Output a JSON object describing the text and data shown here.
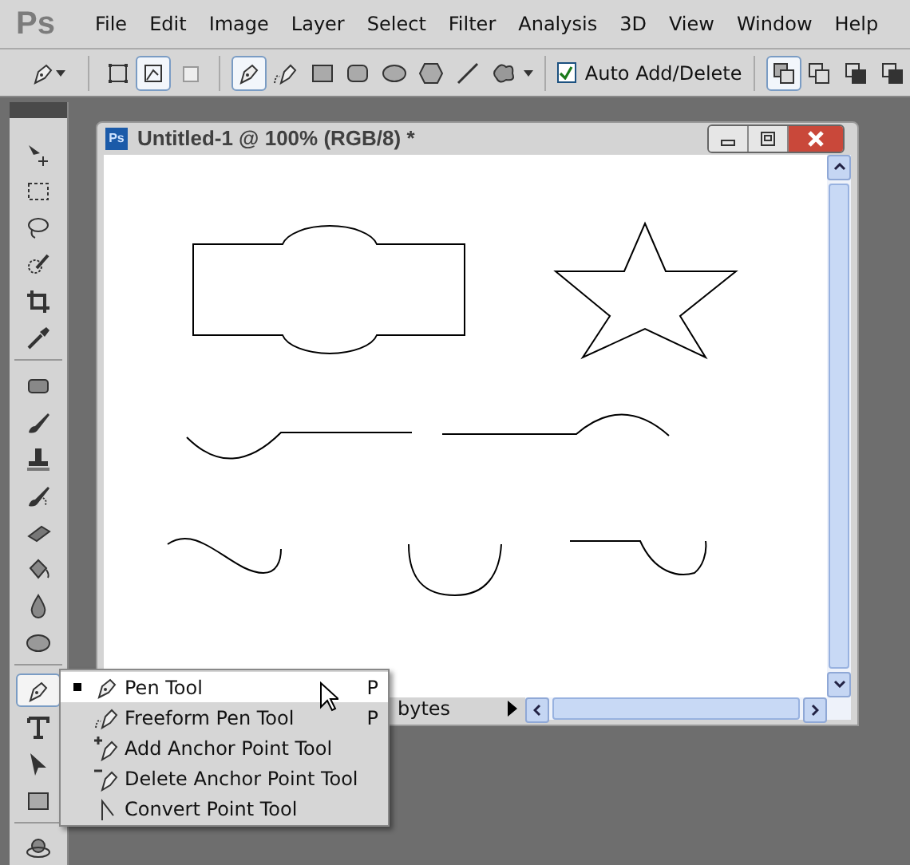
{
  "app_logo": "Ps",
  "menu": [
    "File",
    "Edit",
    "Image",
    "Layer",
    "Select",
    "Filter",
    "Analysis",
    "3D",
    "View",
    "Window",
    "Help"
  ],
  "options_bar": {
    "path_modes": [
      {
        "kind": "shape-layers",
        "selected": false
      },
      {
        "kind": "paths",
        "selected": true
      },
      {
        "kind": "fill-pixels",
        "selected": false
      }
    ],
    "shape_tools": [
      {
        "kind": "pen",
        "selected": true
      },
      {
        "kind": "freeform-pen",
        "selected": false
      },
      {
        "kind": "rectangle",
        "selected": false
      },
      {
        "kind": "rounded-rectangle",
        "selected": false
      },
      {
        "kind": "ellipse",
        "selected": false
      },
      {
        "kind": "polygon",
        "selected": false
      },
      {
        "kind": "line",
        "selected": false
      },
      {
        "kind": "custom-shape",
        "selected": false
      }
    ],
    "auto_add_delete": {
      "label": "Auto Add/Delete",
      "checked": true
    },
    "path_ops": [
      {
        "selected": true
      },
      {
        "selected": false
      },
      {
        "selected": false
      },
      {
        "selected": false
      }
    ]
  },
  "toolbox": [
    {
      "kind": "move",
      "selected": false
    },
    {
      "kind": "marquee",
      "selected": false
    },
    {
      "kind": "lasso",
      "selected": false
    },
    {
      "kind": "quick-select",
      "selected": false
    },
    {
      "kind": "crop",
      "selected": false
    },
    {
      "kind": "eyedropper",
      "selected": false
    },
    {
      "kind": "sep"
    },
    {
      "kind": "healing",
      "selected": false
    },
    {
      "kind": "brush",
      "selected": false
    },
    {
      "kind": "stamp",
      "selected": false
    },
    {
      "kind": "history-brush",
      "selected": false
    },
    {
      "kind": "eraser",
      "selected": false
    },
    {
      "kind": "bucket",
      "selected": false
    },
    {
      "kind": "blur",
      "selected": false
    },
    {
      "kind": "sponge",
      "selected": false
    },
    {
      "kind": "sep"
    },
    {
      "kind": "pen",
      "selected": true
    },
    {
      "kind": "type",
      "selected": false
    },
    {
      "kind": "path-select",
      "selected": false
    },
    {
      "kind": "rectangle",
      "selected": false
    },
    {
      "kind": "sep"
    },
    {
      "kind": "rotate-3d",
      "selected": false
    }
  ],
  "document": {
    "title_icon": "Ps",
    "title": "Untitled-1 @ 100% (RGB/8) *",
    "status": "bytes"
  },
  "flyout": [
    {
      "kind": "pen",
      "label": "Pen Tool",
      "shortcut": "P",
      "selected": true
    },
    {
      "kind": "freeform-pen",
      "label": "Freeform Pen Tool",
      "shortcut": "P",
      "selected": false
    },
    {
      "kind": "add-anchor",
      "label": "Add Anchor Point Tool",
      "selected": false
    },
    {
      "kind": "delete-anchor",
      "label": "Delete Anchor Point Tool",
      "selected": false
    },
    {
      "kind": "convert-point",
      "label": "Convert Point Tool",
      "selected": false
    }
  ]
}
